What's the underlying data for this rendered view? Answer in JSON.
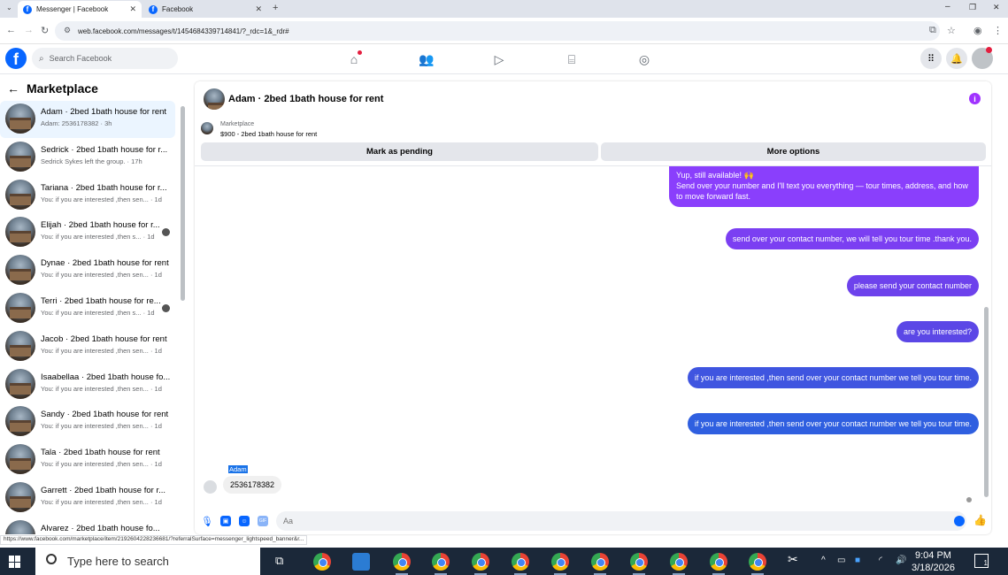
{
  "browser": {
    "tabs": [
      {
        "title": "Messenger | Facebook",
        "active": true
      },
      {
        "title": "Facebook",
        "active": false
      }
    ],
    "url": "web.facebook.com/messages/t/1454684339714841/?_rdc=1&_rdr#",
    "status_url": "https://www.facebook.com/marketplace/item/2192604228236681/?referralSurface=messenger_lightspeed_banner&r..."
  },
  "header": {
    "logo": "f",
    "search_placeholder": "Search Facebook",
    "nav_icons": [
      "home-icon",
      "friends-icon",
      "watch-icon",
      "marketplace-icon",
      "gaming-icon"
    ],
    "accent": "#0866ff"
  },
  "sidebar": {
    "back_label": "←",
    "title": "Marketplace",
    "conversations": [
      {
        "name": "Adam · 2bed 1bath house for rent",
        "preview": "Adam: 2536178382 · 3h",
        "active": true
      },
      {
        "name": "Sedrick · 2bed 1bath house for r...",
        "preview": "Sedrick Sykes left the group. · 17h"
      },
      {
        "name": "Tariana · 2bed 1bath house for r...",
        "preview": "You: if you are interested ,then sen... · 1d"
      },
      {
        "name": "Elijah · 2bed 1bath house for r...",
        "preview": "You: if you are interested ,then s... · 1d"
      },
      {
        "name": "Dynae · 2bed 1bath house for rent",
        "preview": "You: if you are interested ,then sen... · 1d"
      },
      {
        "name": "Terri · 2bed 1bath house for re...",
        "preview": "You: if you are interested ,then s... · 1d"
      },
      {
        "name": "Jacob · 2bed 1bath house for rent",
        "preview": "You: if you are interested ,then sen... · 1d"
      },
      {
        "name": "Isaabellaa · 2bed 1bath house fo...",
        "preview": "You: if you are interested ,then sen... · 1d"
      },
      {
        "name": "Sandy · 2bed 1bath house for rent",
        "preview": "You: if you are interested ,then sen... · 1d"
      },
      {
        "name": "Tala · 2bed 1bath house for rent",
        "preview": "You: if you are interested ,then sen... · 1d"
      },
      {
        "name": "Garrett · 2bed 1bath house for r...",
        "preview": "You: if you are interested ,then sen... · 1d"
      },
      {
        "name": "Alvarez · 2bed 1bath house fo...",
        "preview": ""
      }
    ]
  },
  "chat": {
    "title": "Adam · 2bed 1bath house for rent",
    "listing_source": "Marketplace",
    "listing_line": "$900 - 2bed 1bath house for rent",
    "mark_pending_label": "Mark as pending",
    "more_options_label": "More options",
    "messages": [
      {
        "text": "Yup, still available! 🙌\nSend over your number and I'll text you everything — tour times, address, and how to move forward fast.",
        "color": "#8a3ffc"
      },
      {
        "text": "send over your contact number, we will tell you tour time .thank you.",
        "color": "#7b3ff2"
      },
      {
        "text": "please send your contact number",
        "color": "#6d42ec"
      },
      {
        "text": "are you interested?",
        "color": "#5b47e6"
      },
      {
        "text": "if you are interested ,then send over your contact number we tell you tour time.",
        "color": "#3f55e0"
      },
      {
        "text": "if you are interested ,then send over your contact number we tell you tour time.",
        "color": "#2f5fe0"
      }
    ],
    "sender_label": "Adam",
    "received_text": "2536178382",
    "composer_placeholder": "Aa"
  },
  "taskbar": {
    "search_placeholder": "Type here to search",
    "time": "9:04 PM",
    "date": "3/18/2026",
    "notification_count": "1"
  }
}
